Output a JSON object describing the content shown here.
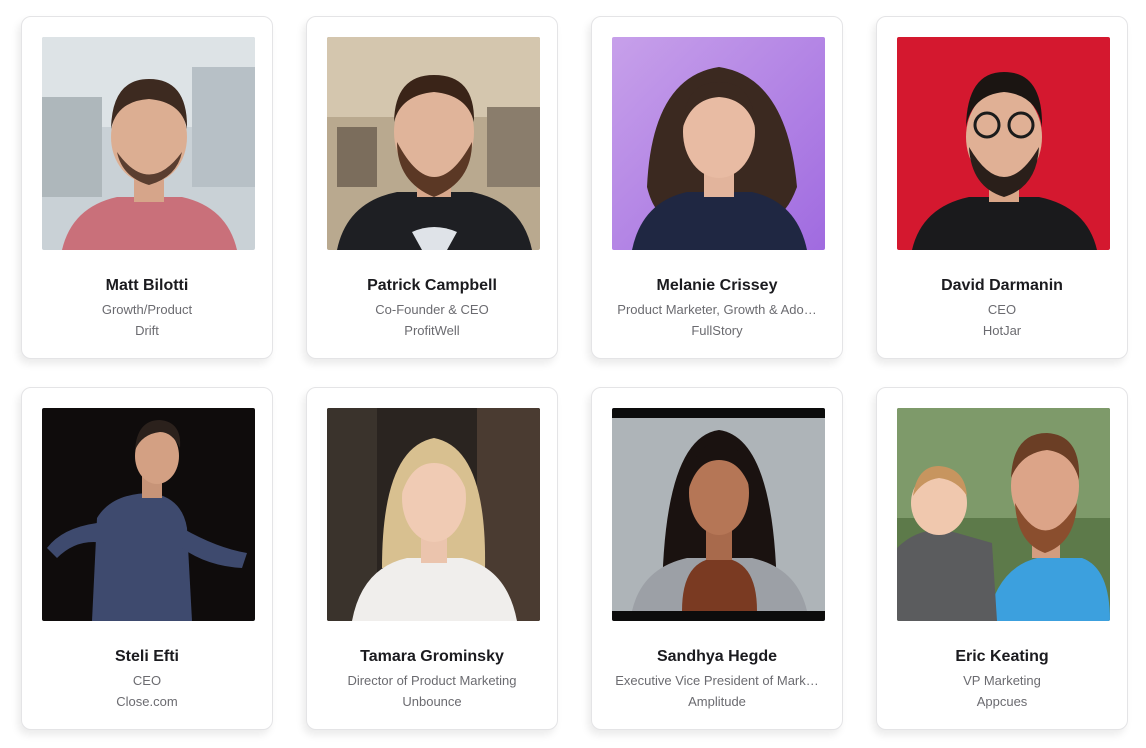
{
  "speakers": [
    {
      "name": "Matt Bilotti",
      "role": "Growth/Product",
      "company": "Drift"
    },
    {
      "name": "Patrick Campbell",
      "role": "Co-Founder & CEO",
      "company": "ProfitWell"
    },
    {
      "name": "Melanie Crissey",
      "role": "Product Marketer, Growth & Ado…",
      "company": "FullStory"
    },
    {
      "name": "David Darmanin",
      "role": "CEO",
      "company": "HotJar"
    },
    {
      "name": "Steli Efti",
      "role": "CEO",
      "company": "Close.com"
    },
    {
      "name": "Tamara Grominsky",
      "role": "Director of Product Marketing",
      "company": "Unbounce"
    },
    {
      "name": "Sandhya Hegde",
      "role": "Executive Vice President of Mark…",
      "company": "Amplitude"
    },
    {
      "name": "Eric Keating",
      "role": "VP Marketing",
      "company": "Appcues"
    }
  ]
}
